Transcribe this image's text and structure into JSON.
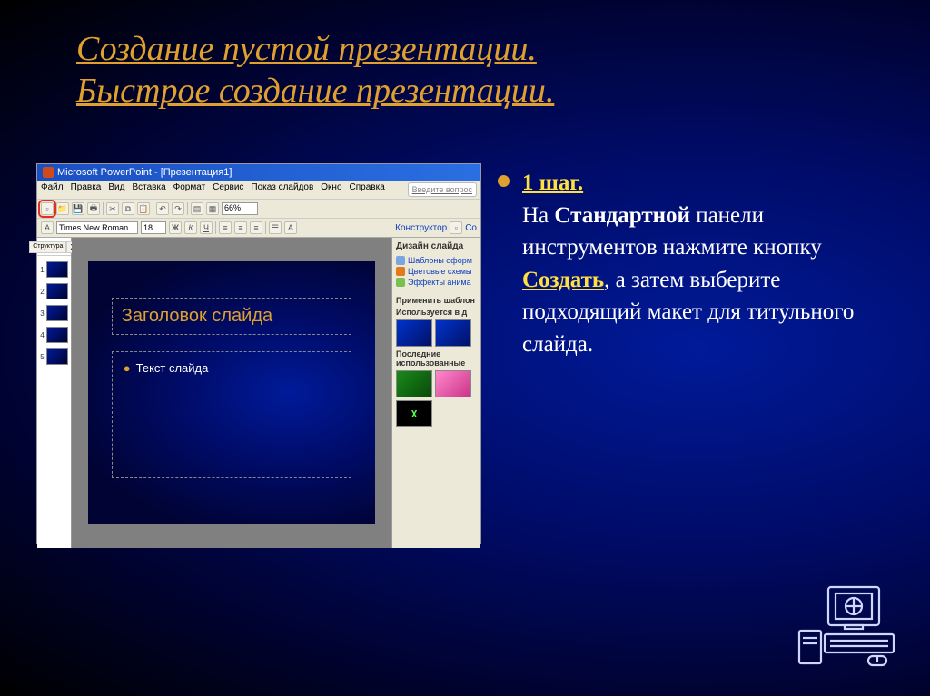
{
  "title": {
    "line1": "Создание пустой презентации.",
    "line2": "Быстрое создание презентации."
  },
  "screenshot": {
    "app_title": "Microsoft PowerPoint - [Презентация1]",
    "menu": [
      "Файл",
      "Правка",
      "Вид",
      "Вставка",
      "Формат",
      "Сервис",
      "Показ слайдов",
      "Окно",
      "Справка"
    ],
    "question_placeholder": "Введите вопрос",
    "toolbar": {
      "new_tooltip": "Создать",
      "zoom": "66%"
    },
    "format_bar": {
      "font": "Times New Roman",
      "size": "18",
      "constructor": "Конструктор",
      "create_slide": "Со"
    },
    "outline": {
      "tabs": [
        "Структура",
        "X"
      ],
      "thumbs": [
        "1",
        "2",
        "3",
        "4",
        "5"
      ]
    },
    "slide": {
      "title_ph": "Заголовок слайда",
      "body_ph": "Текст слайда"
    },
    "taskpane": {
      "header": "Дизайн слайда",
      "links": [
        "Шаблоны оформ",
        "Цветовые схемы",
        "Эффекты анима"
      ],
      "apply_label": "Применить шаблон",
      "used_label": "Используется в д",
      "recent_label": "Последние использованные"
    }
  },
  "content": {
    "step_title": "1 шаг.",
    "p1_a": "На ",
    "p1_bold": "Стандартной",
    "p1_b": " панели инструментов нажмите кнопку ",
    "p1_link": "Создать",
    "p1_c": ", а затем выберите подходящий макет для титульного слайда."
  }
}
